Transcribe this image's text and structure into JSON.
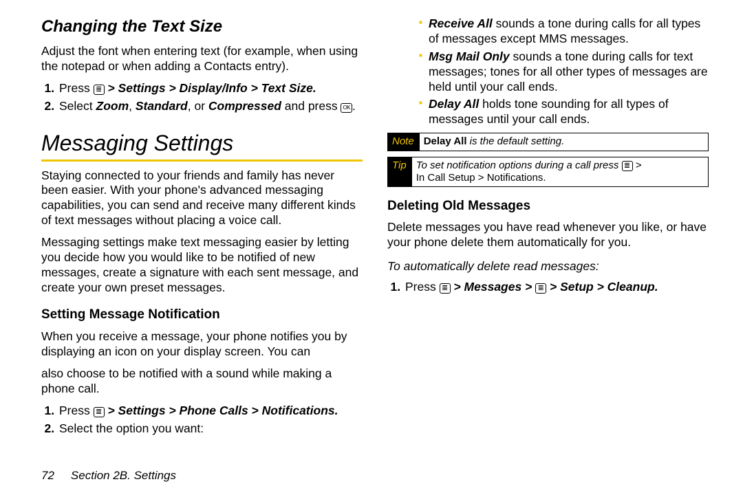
{
  "left": {
    "h2_changing": "Changing the Text Size",
    "changing_intro": "Adjust the font when entering text (for example, when using the notepad or when adding a Contacts entry).",
    "step1_prefix": "Press ",
    "step1_path": " > Settings > Display/Info > Text Size.",
    "step2a": "Select ",
    "step2_zoom": "Zoom",
    "step2_sep1": ", ",
    "step2_std": "Standard",
    "step2_sep2": ", or ",
    "step2_comp": "Compressed",
    "step2b": " and press ",
    "step2c": ".",
    "h1_msg": "Messaging Settings",
    "msg_p1": "Staying connected to your friends and family has never been easier. With your phone's advanced messaging capabilities, you can send and receive many different kinds of text messages without placing a voice call.",
    "msg_p2": "Messaging settings make text messaging easier by letting you decide how you would like to be notified of new messages, create a signature with each sent message, and create your own preset messages.",
    "h3_setnotif": "Setting Message Notification",
    "setnotif_p": "When you receive a message, your phone notifies you by displaying an icon on your display screen. You can"
  },
  "right": {
    "cont": "also choose to be notified with a sound while making a phone call.",
    "r_step1_prefix": "Press ",
    "r_step1_path": " > Settings > Phone Calls > Notifications.",
    "r_step2": "Select the option you want:",
    "opt1_lead": "Receive All",
    "opt1_body": " sounds a tone during calls for all types of messages except MMS messages.",
    "opt2_lead": "Msg Mail Only",
    "opt2_body": " sounds a tone during calls for text messages; tones for all other types of messages are held until your call ends.",
    "opt3_lead": "Delay All",
    "opt3_body": " holds tone sounding for all types of messages until your call ends.",
    "note_label": "Note",
    "note_bold": "Delay All",
    "note_rest": " is the default setting.",
    "tip_label": "Tip",
    "tip_a": "To set notification options during a call press ",
    "tip_b": " > ",
    "tip_c": "In Call Setup > Notifications.",
    "h3_delete": "Deleting Old Messages",
    "delete_p": "Delete messages you have read whenever you like, or have your phone delete them automatically for you.",
    "task_lead": "To automatically delete read messages:",
    "d_step1_prefix": "Press ",
    "d_step1_mid": " > Messages > ",
    "d_step1_end": " > Setup > Cleanup."
  },
  "footer": {
    "page": "72",
    "section": "Section 2B. Settings"
  }
}
